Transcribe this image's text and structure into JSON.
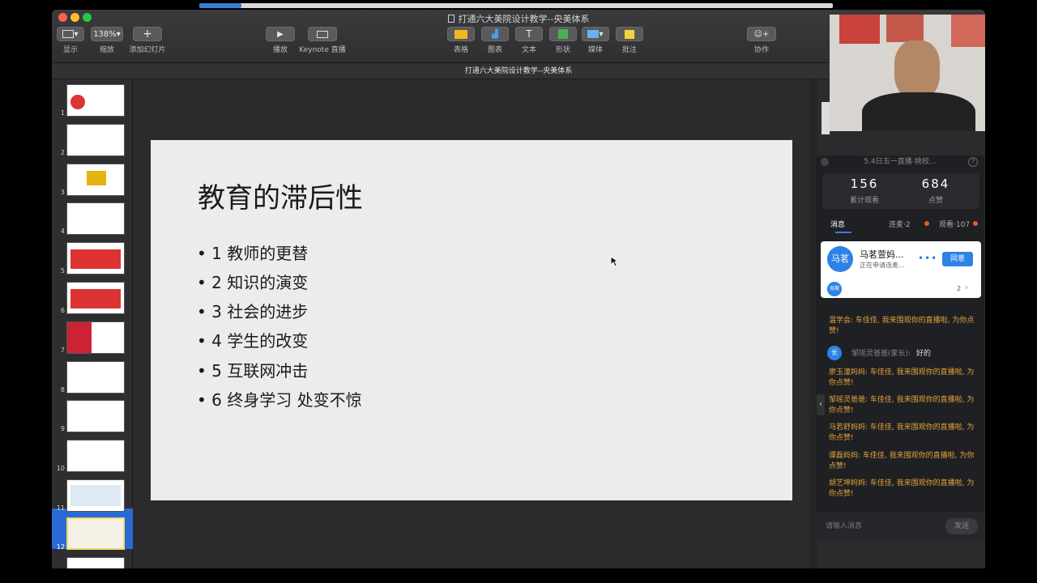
{
  "window": {
    "title": "打通六大美院设计教学--央美体系",
    "doc_title": "打通六大美院设计教学--央美体系"
  },
  "toolbar": {
    "view_label": "显示",
    "zoom_value": "138%",
    "zoom_label": "缩放",
    "add_slide_label": "添加幻灯片",
    "play_label": "播放",
    "keynote_live_label": "Keynote 直播",
    "table_label": "表格",
    "chart_label": "图表",
    "text_label": "文本",
    "shape_label": "形状",
    "media_label": "媒体",
    "comment_label": "批注",
    "collab_label": "协作"
  },
  "sidebar": {
    "slide_numbers": [
      "1",
      "2",
      "3",
      "4",
      "5",
      "6",
      "7",
      "8",
      "9",
      "10",
      "11",
      "12"
    ],
    "selected": "12"
  },
  "slide": {
    "title": "教育的滞后性",
    "bullets": [
      "• 1 教师的更替",
      "• 2 知识的演变",
      "• 3 社会的进步",
      "• 4 学生的改变",
      "• 5 互联网冲击",
      "• 6 终身学习 处变不惊"
    ]
  },
  "live": {
    "header": "5.4日五一直播-姚校...",
    "views": "156",
    "views_label": "累计观看",
    "likes": "684",
    "likes_label": "点赞",
    "tab_messages": "消息",
    "tab_connect": "连麦·2",
    "tab_viewers": "观看·107",
    "request_avatar": "马茗",
    "request_name": "马茗萱妈...",
    "request_status": "正在申请连麦...",
    "agree_label": "同意",
    "small_avatar": "吴猷",
    "count": "2",
    "messages": [
      {
        "text": "温学会: 车佳佳, 我来围观你的直播啦, 为你点赞!"
      },
      {
        "badge": "长",
        "name": "邹瑶灵爸爸(家长):",
        "text": "好的"
      },
      {
        "text": "廖玉潼妈妈: 车佳佳, 我来围观你的直播啦, 为你点赞!"
      },
      {
        "text": "邹瑶灵爸爸: 车佳佳, 我来围观你的直播啦, 为你点赞!"
      },
      {
        "text": "马若舒妈妈: 车佳佳, 我来围观你的直播啦, 为你点赞!"
      },
      {
        "text": "谭磊妈妈: 车佳佳, 我来围观你的直播啦, 为你点赞!"
      },
      {
        "text": "胡艺坤妈妈: 车佳佳, 我来围观你的直播啦, 为你点赞!"
      }
    ],
    "input_placeholder": "请输入消息",
    "send_label": "发送"
  },
  "colors": {
    "accent": "#3a7bd5",
    "live_orange": "#e3a23a",
    "slide_bg": "#ececec"
  }
}
